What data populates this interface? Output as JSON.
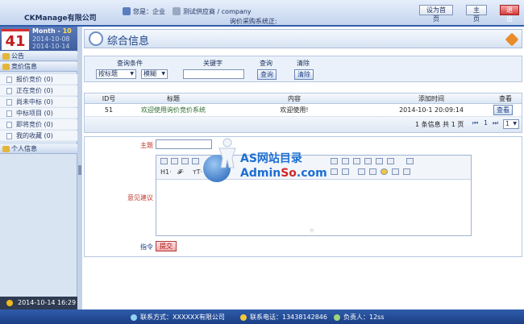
{
  "header": {
    "company": "CKManage有限公司",
    "greeting": "您是：企业",
    "supplier": "测试供应商 / company",
    "system": "询价采购系统正:",
    "btn_home": "设为首页",
    "btn_main": "主页",
    "btn_logout": "退出"
  },
  "sidebar": {
    "day": "41",
    "month_label": "Month",
    "month_num": "10",
    "date1": "2014-10-08",
    "date2": "2014-10-14",
    "sections": [
      {
        "label": "公告"
      },
      {
        "label": "竞价信息"
      }
    ],
    "items": [
      {
        "label": "报价竞价 (0)"
      },
      {
        "label": "正在竞价 (0)"
      },
      {
        "label": "尚未中标 (0)"
      },
      {
        "label": "中标项目 (0)"
      },
      {
        "label": "即将竞价 (0)"
      },
      {
        "label": "我的收藏 (0)"
      }
    ],
    "personal": "个人信息",
    "clock": "2014-10-14 16:29"
  },
  "page": {
    "title": "综合信息"
  },
  "query": {
    "condition_label": "查询条件",
    "keyword_label": "关键字",
    "search_label": "查询",
    "clear_label": "清除",
    "field_select": "按标题",
    "mode_select": "模糊",
    "search_btn": "查询",
    "clear_btn": "清除"
  },
  "table": {
    "headers": [
      "ID号",
      "标题",
      "内容",
      "添加时间",
      "查看"
    ],
    "rows": [
      {
        "id": "51",
        "title": "欢迎使用询价竞价系统",
        "content": "欢迎使用!",
        "time": "2014-10-1 20:09:14",
        "view": "查看"
      }
    ],
    "pager_info": "1 条信息  共 1 页",
    "page_current": "1",
    "page_select": "1"
  },
  "form": {
    "subject_label": "主题",
    "toolbar_h": "H1·",
    "toolbar_f": "𝓕·",
    "toolbar_t": "тT·",
    "suggest_label": "意见建议",
    "command_label": "指令",
    "submit_btn": "提交"
  },
  "watermark": {
    "line1": "AS网站目录",
    "line2_a": "Admin",
    "line2_b": "So",
    "line2_c": ".com"
  },
  "footer": {
    "contact": "联系方式：XXXXXX有限公司",
    "phone": "联系电话：13438142846",
    "person": "负责人：12ss"
  }
}
